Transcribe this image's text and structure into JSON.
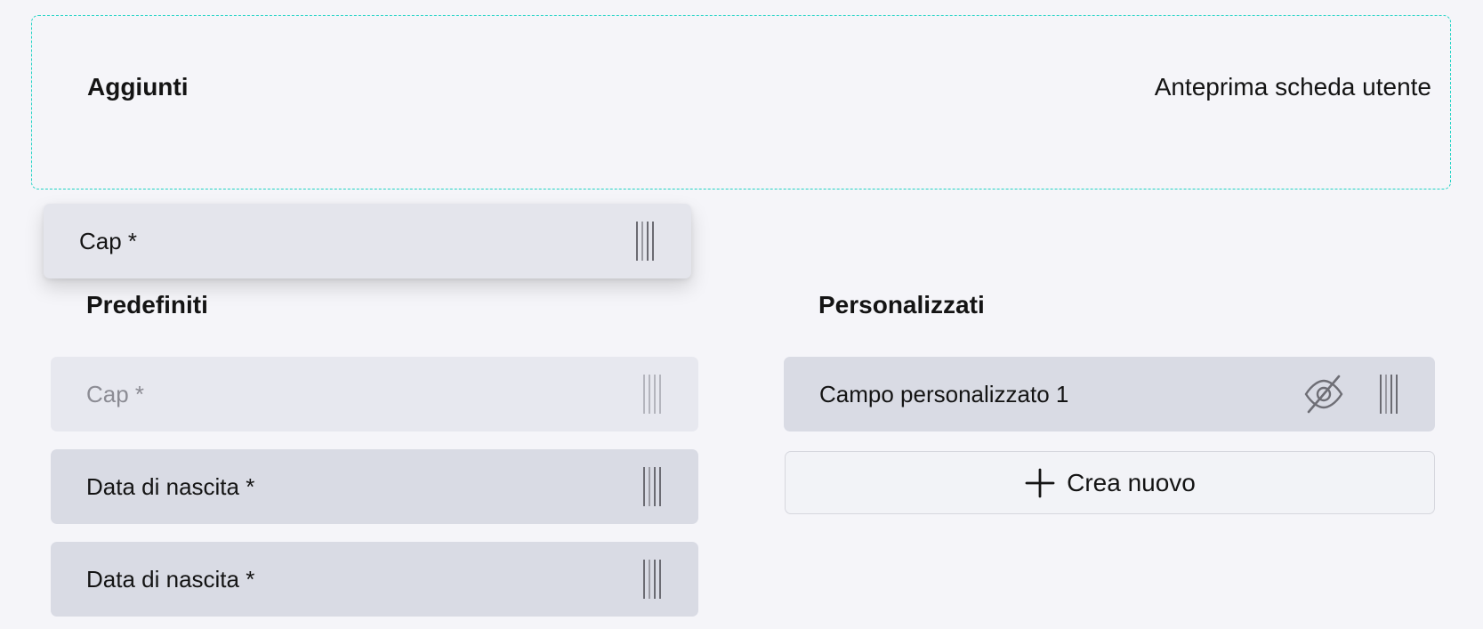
{
  "dropzone": {
    "title": "Aggiunti",
    "preview_link": "Anteprima scheda utente"
  },
  "dragging_item": {
    "label": "Cap *"
  },
  "predefiniti": {
    "title": "Predefiniti",
    "items": [
      {
        "label": "Cap *",
        "state": "placeholder"
      },
      {
        "label": "Data di nascita *",
        "state": "normal"
      },
      {
        "label": "Data di nascita *",
        "state": "normal"
      }
    ]
  },
  "personalizzati": {
    "title": "Personalizzati",
    "items": [
      {
        "label": "Campo personalizzato 1",
        "hidden_icon": "eye-off-icon"
      }
    ],
    "create_label": "Crea nuovo"
  },
  "colors": {
    "background": "#f5f5f9",
    "dropzone_border": "#22d3c5",
    "field_bg": "#d9dbe4",
    "placeholder_text": "#8c8c94"
  }
}
